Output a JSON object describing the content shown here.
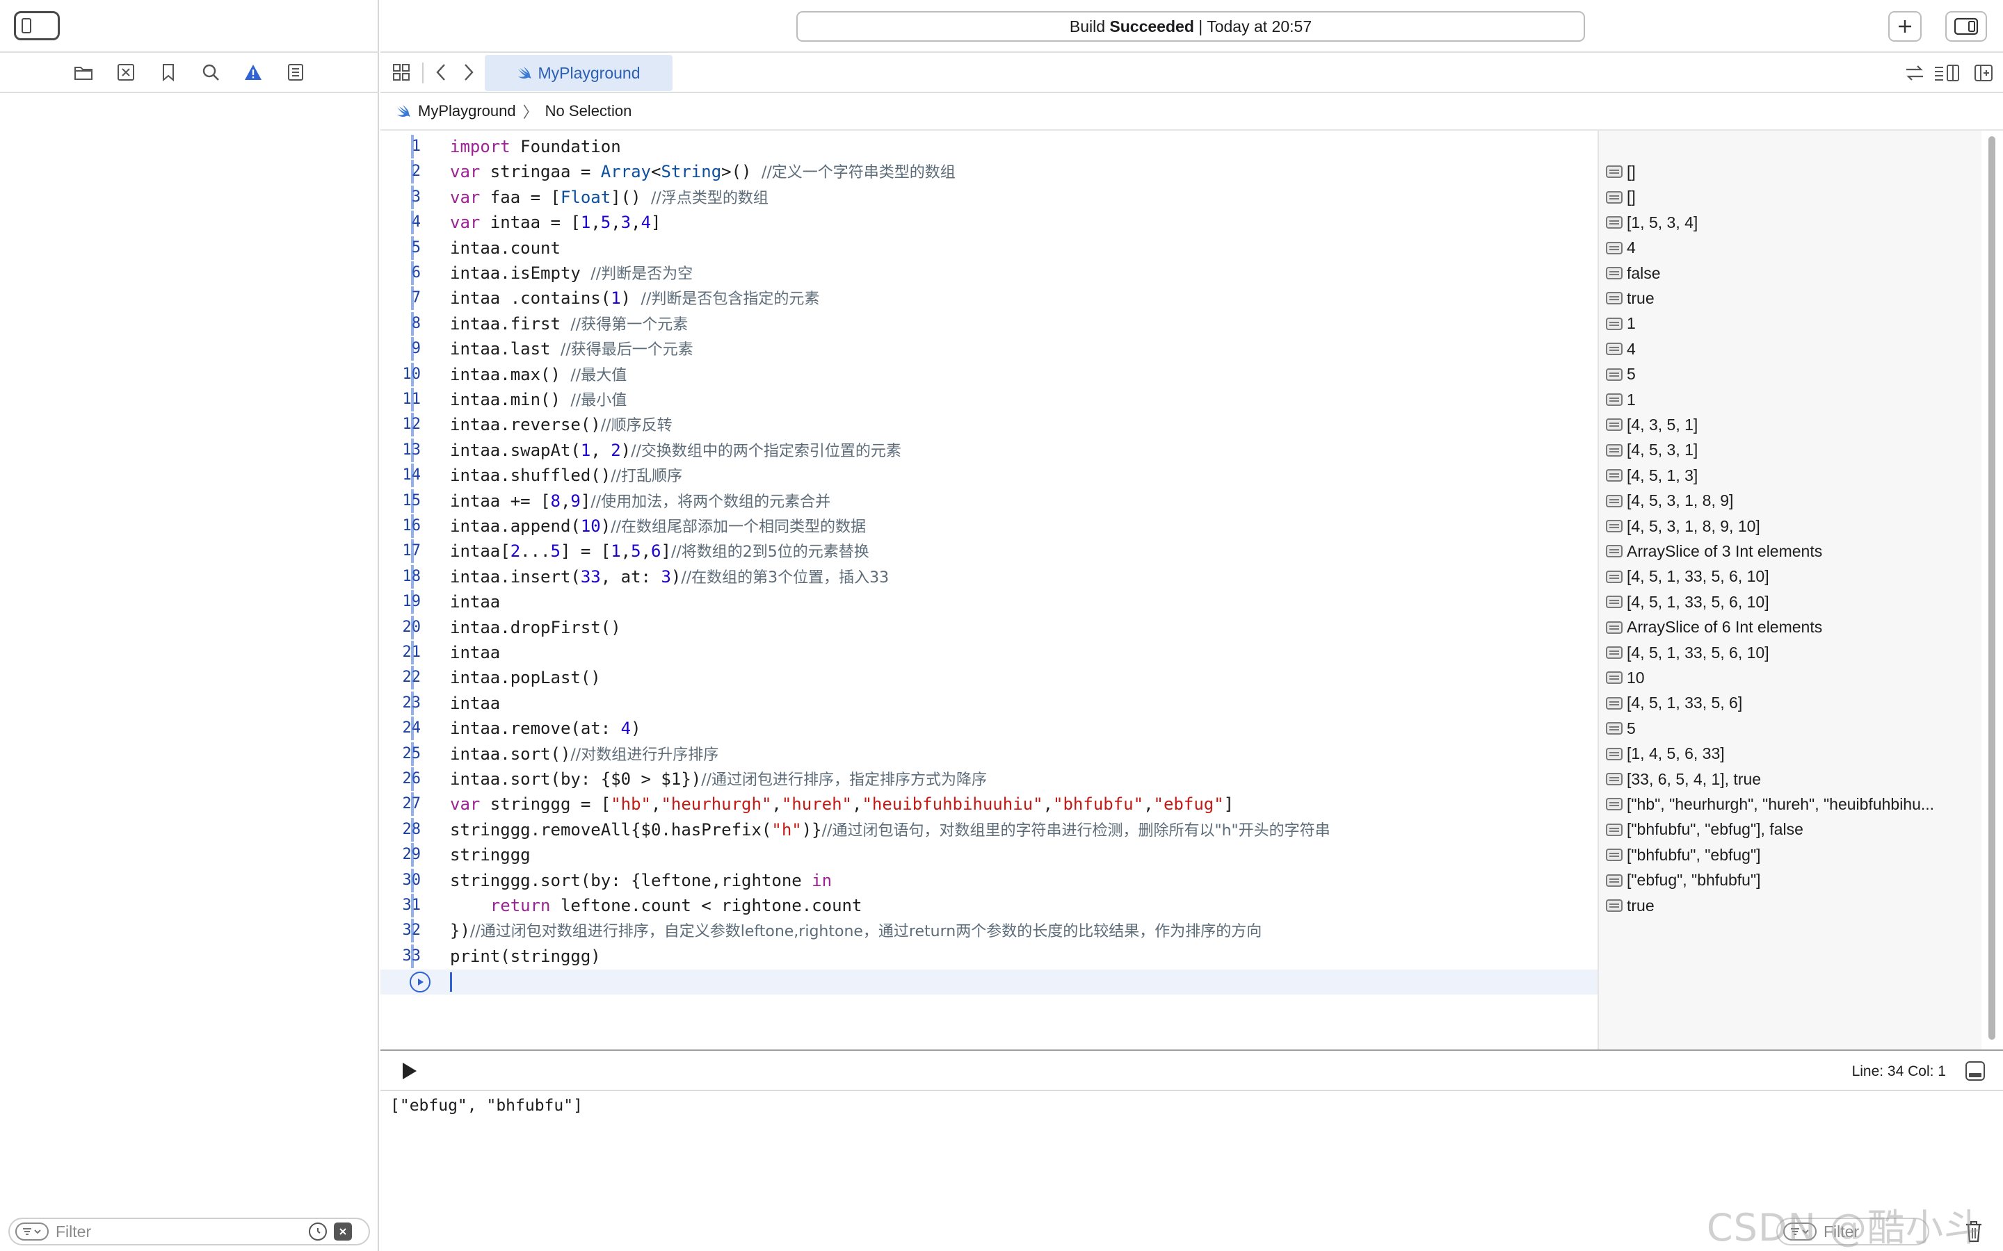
{
  "activity": {
    "status_strong": "Succeeded",
    "status_prefix": "Build",
    "status_time": "| Today at 20:57"
  },
  "tab": {
    "label": "MyPlayground"
  },
  "jumpbar": {
    "file": "MyPlayground",
    "separator": "〉",
    "selection": "No Selection"
  },
  "sidebar": {
    "filter_placeholder": "Filter",
    "icons": [
      "folder-icon",
      "source-control-icon",
      "bookmark-icon",
      "find-icon",
      "issue-icon",
      "report-icon"
    ]
  },
  "editor": {
    "lines": [
      {
        "n": "1",
        "html": "<span class=\"kw\">import</span> Foundation"
      },
      {
        "n": "2",
        "html": "<span class=\"kw\">var</span> stringaa = <span class=\"ty\">Array</span>&lt;<span class=\"ty\">String</span>&gt;() <span class=\"cm\">//定义一个字符串类型的数组</span>"
      },
      {
        "n": "3",
        "html": "<span class=\"kw\">var</span> faa = [<span class=\"ty\">Float</span>]() <span class=\"cm\">//浮点类型的数组</span>"
      },
      {
        "n": "4",
        "html": "<span class=\"kw\">var</span> intaa = [<span class=\"num\">1</span>,<span class=\"num\">5</span>,<span class=\"num\">3</span>,<span class=\"num\">4</span>]"
      },
      {
        "n": "5",
        "html": "intaa.count"
      },
      {
        "n": "6",
        "html": "intaa.isEmpty <span class=\"cm\">//判断是否为空</span>"
      },
      {
        "n": "7",
        "html": "intaa .contains(<span class=\"num\">1</span>) <span class=\"cm\">//判断是否包含指定的元素</span>"
      },
      {
        "n": "8",
        "html": "intaa.first <span class=\"cm\">//获得第一个元素</span>"
      },
      {
        "n": "9",
        "html": "intaa.last <span class=\"cm\">//获得最后一个元素</span>"
      },
      {
        "n": "10",
        "html": "intaa.max() <span class=\"cm\">//最大值</span>"
      },
      {
        "n": "11",
        "html": "intaa.min() <span class=\"cm\">//最小值</span>"
      },
      {
        "n": "12",
        "html": "intaa.reverse()<span class=\"cm\">//顺序反转</span>"
      },
      {
        "n": "13",
        "html": "intaa.swapAt(<span class=\"num\">1</span>, <span class=\"num\">2</span>)<span class=\"cm\">//交换数组中的两个指定索引位置的元素</span>"
      },
      {
        "n": "14",
        "html": "intaa.shuffled()<span class=\"cm\">//打乱顺序</span>"
      },
      {
        "n": "15",
        "html": "intaa += [<span class=\"num\">8</span>,<span class=\"num\">9</span>]<span class=\"cm\">//使用加法，将两个数组的元素合并</span>"
      },
      {
        "n": "16",
        "html": "intaa.append(<span class=\"num\">10</span>)<span class=\"cm\">//在数组尾部添加一个相同类型的数据</span>"
      },
      {
        "n": "17",
        "html": "intaa[<span class=\"num\">2</span>...<span class=\"num\">5</span>] = [<span class=\"num\">1</span>,<span class=\"num\">5</span>,<span class=\"num\">6</span>]<span class=\"cm\">//将数组的2到5位的元素替换</span>"
      },
      {
        "n": "18",
        "html": "intaa.insert(<span class=\"num\">33</span>, at: <span class=\"num\">3</span>)<span class=\"cm\">//在数组的第3个位置，插入33</span>"
      },
      {
        "n": "19",
        "html": "intaa"
      },
      {
        "n": "20",
        "html": "intaa.dropFirst()"
      },
      {
        "n": "21",
        "html": "intaa"
      },
      {
        "n": "22",
        "html": "intaa.popLast()"
      },
      {
        "n": "23",
        "html": "intaa"
      },
      {
        "n": "24",
        "html": "intaa.remove(at: <span class=\"num\">4</span>)"
      },
      {
        "n": "25",
        "html": "intaa.sort()<span class=\"cm\">//对数组进行升序排序</span>"
      },
      {
        "n": "26",
        "html": "intaa.sort(by: {$0 &gt; $1})<span class=\"cm\">//通过闭包进行排序，指定排序方式为降序</span>"
      },
      {
        "n": "27",
        "html": "<span class=\"kw\">var</span> stringgg = [<span class=\"str\">\"hb\"</span>,<span class=\"str\">\"heurhurgh\"</span>,<span class=\"str\">\"hureh\"</span>,<span class=\"str\">\"heuibfuhbihuuhiu\"</span>,<span class=\"str\">\"bhfubfu\"</span>,<span class=\"str\">\"ebfug\"</span>]"
      },
      {
        "n": "28",
        "html": "stringgg.removeAll{$0.hasPrefix(<span class=\"str\">\"h\"</span>)}<span class=\"cm\">//通过闭包语句，对数组里的字符串进行检测，删除所有以\"h\"开头的字符串</span>"
      },
      {
        "n": "29",
        "html": "stringgg"
      },
      {
        "n": "30",
        "html": "stringgg.sort(by: {leftone,rightone <span class=\"kw\">in</span>"
      },
      {
        "n": "31",
        "html": "    <span class=\"kw\">return</span> leftone.count &lt; rightone.count"
      },
      {
        "n": "32",
        "html": "})<span class=\"cm\">//通过闭包对数组进行排序，自定义参数leftone,rightone，通过return两个参数的长度的比较结果，作为排序的方向</span>"
      },
      {
        "n": "33",
        "html": "print(stringgg)"
      }
    ]
  },
  "results": [
    {
      "row": 1,
      "value": "[]"
    },
    {
      "row": 2,
      "value": "[]"
    },
    {
      "row": 3,
      "value": "[1, 5, 3, 4]"
    },
    {
      "row": 4,
      "value": "4"
    },
    {
      "row": 5,
      "value": "false"
    },
    {
      "row": 6,
      "value": "true"
    },
    {
      "row": 7,
      "value": "1"
    },
    {
      "row": 8,
      "value": "4"
    },
    {
      "row": 9,
      "value": "5"
    },
    {
      "row": 10,
      "value": "1"
    },
    {
      "row": 11,
      "value": "[4, 3, 5, 1]"
    },
    {
      "row": 12,
      "value": "[4, 5, 3, 1]"
    },
    {
      "row": 13,
      "value": "[4, 5, 1, 3]"
    },
    {
      "row": 14,
      "value": "[4, 5, 3, 1, 8, 9]"
    },
    {
      "row": 15,
      "value": "[4, 5, 3, 1, 8, 9, 10]"
    },
    {
      "row": 16,
      "value": "ArraySlice of 3 Int elements"
    },
    {
      "row": 17,
      "value": "[4, 5, 1, 33, 5, 6, 10]"
    },
    {
      "row": 18,
      "value": "[4, 5, 1, 33, 5, 6, 10]"
    },
    {
      "row": 19,
      "value": "ArraySlice of 6 Int elements"
    },
    {
      "row": 20,
      "value": "[4, 5, 1, 33, 5, 6, 10]"
    },
    {
      "row": 21,
      "value": "10"
    },
    {
      "row": 22,
      "value": "[4, 5, 1, 33, 5, 6]"
    },
    {
      "row": 23,
      "value": "5"
    },
    {
      "row": 24,
      "value": "[1, 4, 5, 6, 33]"
    },
    {
      "row": 25,
      "value": "[33, 6, 5, 4, 1], true"
    },
    {
      "row": 26,
      "value": "[\"hb\", \"heurhurgh\", \"hureh\", \"heuibfuhbihu..."
    },
    {
      "row": 27,
      "value": "[\"bhfubfu\", \"ebfug\"], false"
    },
    {
      "row": 28,
      "value": "[\"bhfubfu\", \"ebfug\"]"
    },
    {
      "row": 29,
      "value": "[\"ebfug\", \"bhfubfu\"]"
    },
    {
      "row": 30,
      "value": "true"
    }
  ],
  "debug": {
    "position": "Line: 34  Col: 1"
  },
  "console": {
    "output": "[\"ebfug\", \"bhfubfu\"]",
    "filter_placeholder": "Filter"
  },
  "watermark": "CSDN @酷小斗",
  "colors": {
    "accent": "#2f62d4",
    "keyword": "#9b2393",
    "type": "#0b4f9e",
    "number": "#1c00cf",
    "string": "#c41a16",
    "comment": "#5d6c79",
    "issue": "#2f62d4"
  }
}
